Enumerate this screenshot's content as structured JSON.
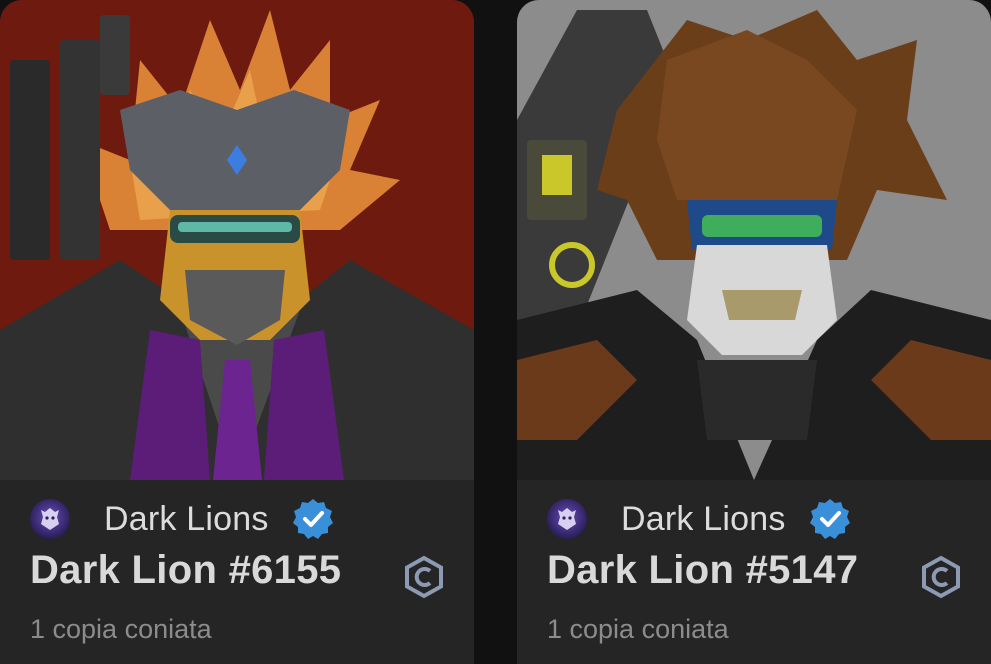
{
  "cards": [
    {
      "collection": "Dark Lions",
      "title": "Dark Lion #6155",
      "minted": "1 copia coniata",
      "bg_color": "#7a1d10"
    },
    {
      "collection": "Dark Lions",
      "title": "Dark Lion #5147",
      "minted": "1 copia coniata",
      "bg_color": "#8a8a8a"
    }
  ],
  "icons": {
    "verified": "verified-badge-icon",
    "chain": "chain-c-icon",
    "avatar": "dark-lions-avatar"
  },
  "colors": {
    "verified_blue": "#3a8fd9",
    "chain_icon": "#8c9bb3"
  }
}
